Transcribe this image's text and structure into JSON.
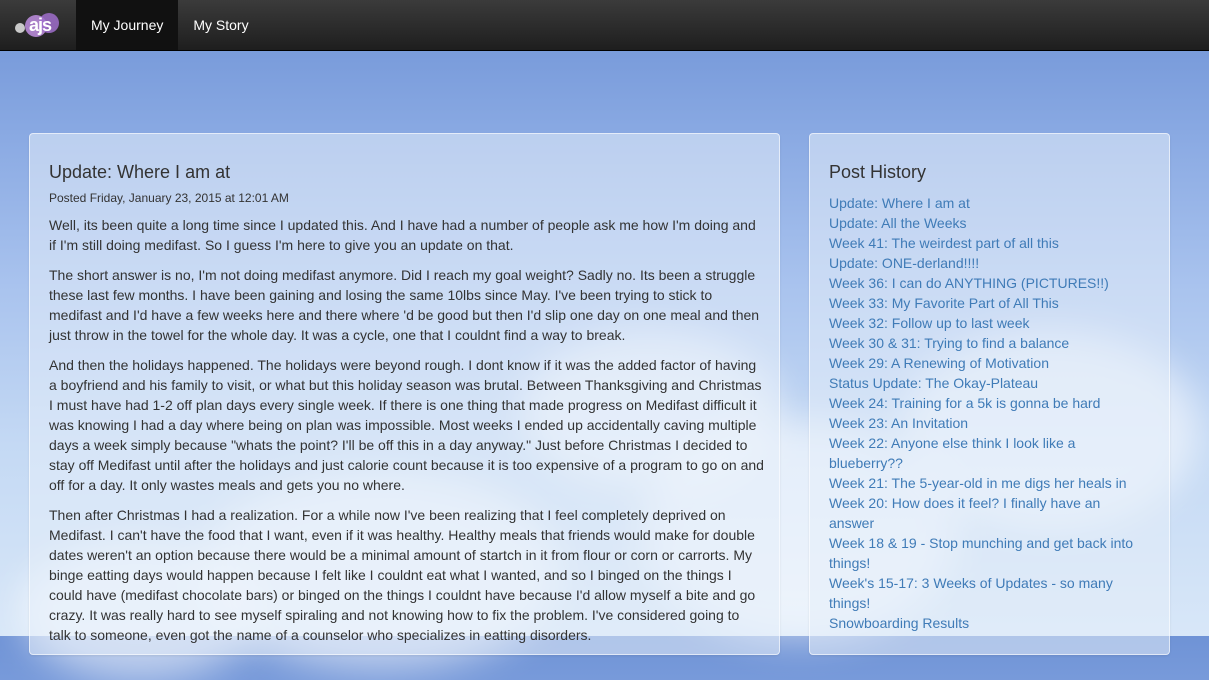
{
  "nav": {
    "logo_text": "ajs",
    "items": [
      {
        "label": "My Journey",
        "active": true
      },
      {
        "label": "My Story",
        "active": false
      }
    ]
  },
  "post": {
    "title": "Update: Where I am at",
    "posted": "Posted Friday, January 23, 2015 at 12:01 AM",
    "paragraphs": [
      "Well, its been quite a long time since I updated this. And I have had a number of people ask me how I'm doing and if I'm still doing medifast. So I guess I'm here to give you an update on that.",
      "The short answer is no, I'm not doing medifast anymore. Did I reach my goal weight? Sadly no. Its been a struggle these last few months. I have been gaining and losing the same 10lbs since May. I've been trying to stick to medifast and I'd have a few weeks here and there where 'd be good but then I'd slip one day on one meal and then just throw in the towel for the whole day. It was a cycle, one that I couldnt find a way to break.",
      "And then the holidays happened. The holidays were beyond rough. I dont know if it was the added factor of having a boyfriend and his family to visit, or what but this holiday season was brutal. Between Thanksgiving and Christmas I must have had 1-2 off plan days every single week. If there is one thing that made progress on Medifast difficult it was knowing I had a day where being on plan was impossible. Most weeks I ended up accidentally caving multiple days a week simply because \"whats the point? I'll be off this in a day anyway.\" Just before Christmas I decided to stay off Medifast until after the holidays and just calorie count because it is too expensive of a program to go on and off for a day. It only wastes meals and gets you no where.",
      "Then after Christmas I had a realization. For a while now I've been realizing that I feel completely deprived on Medifast. I can't have the food that I want, even if it was healthy. Healthy meals that friends would make for double dates weren't an option because there would be a minimal amount of startch in it from flour or corn or carrorts. My binge eatting days would happen because I felt like I couldnt eat what I wanted, and so I binged on the things I could have (medifast chocolate bars) or binged on the things I couldnt have because I'd allow myself a bite and go crazy. It was really hard to see myself spiraling and not knowing how to fix the problem. I've considered going to talk to someone, even got the name of a counselor who specializes in eatting disorders."
    ]
  },
  "sidebar": {
    "title": "Post History",
    "links": [
      "Update: Where I am at",
      "Update: All the Weeks",
      "Week 41: The weirdest part of all this",
      "Update: ONE-derland!!!!",
      "Week 36: I can do ANYTHING (PICTURES!!)",
      "Week 33: My Favorite Part of All This",
      "Week 32: Follow up to last week",
      "Week 30 & 31: Trying to find a balance",
      "Week 29: A Renewing of Motivation",
      "Status Update: The Okay-Plateau",
      "Week 24: Training for a 5k is gonna be hard",
      "Week 23: An Invitation",
      "Week 22: Anyone else think I look like a blueberry??",
      "Week 21: The 5-year-old in me digs her heals in",
      "Week 20: How does it feel? I finally have an answer",
      "Week 18 & 19 - Stop munching and get back into things!",
      "Week's 15-17: 3 Weeks of Updates - so many things!",
      "Snowboarding Results"
    ]
  }
}
